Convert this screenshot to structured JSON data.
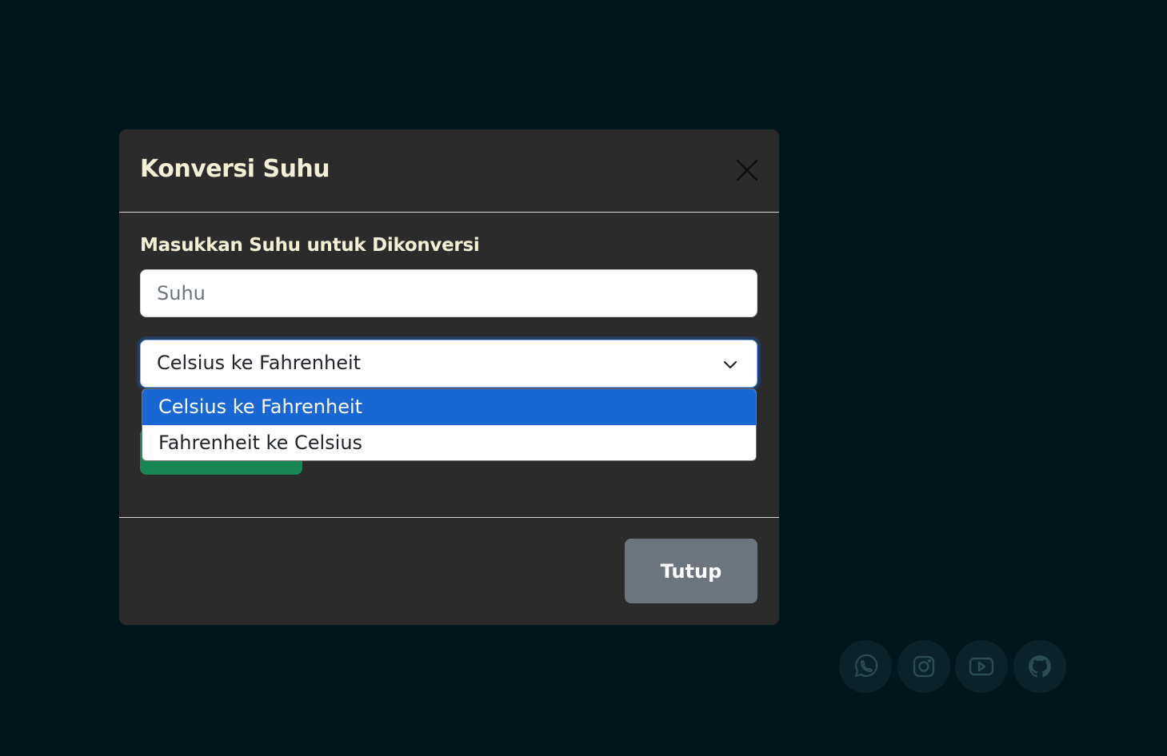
{
  "modal": {
    "title": "Konversi Suhu",
    "close_icon": "close-icon",
    "body": {
      "label": "Masukkan Suhu untuk Dikonversi",
      "input_placeholder": "Suhu",
      "input_value": "",
      "select_value": "Celsius ke Fahrenheit",
      "options": [
        "Celsius ke Fahrenheit",
        "Fahrenheit ke Celsius"
      ],
      "selected_option_index": 0
    },
    "footer": {
      "close_label": "Tutup"
    }
  },
  "social": {
    "icons": [
      "whatsapp-icon",
      "instagram-icon",
      "youtube-icon",
      "github-icon"
    ]
  },
  "colors": {
    "page_background": "#01161b",
    "modal_background": "#2b2b2b",
    "title_color": "#f2efd6",
    "selected_option": "#1967d2",
    "convert_button": "#198754",
    "close_button": "#6c757d",
    "social_background": "#0a2328"
  }
}
